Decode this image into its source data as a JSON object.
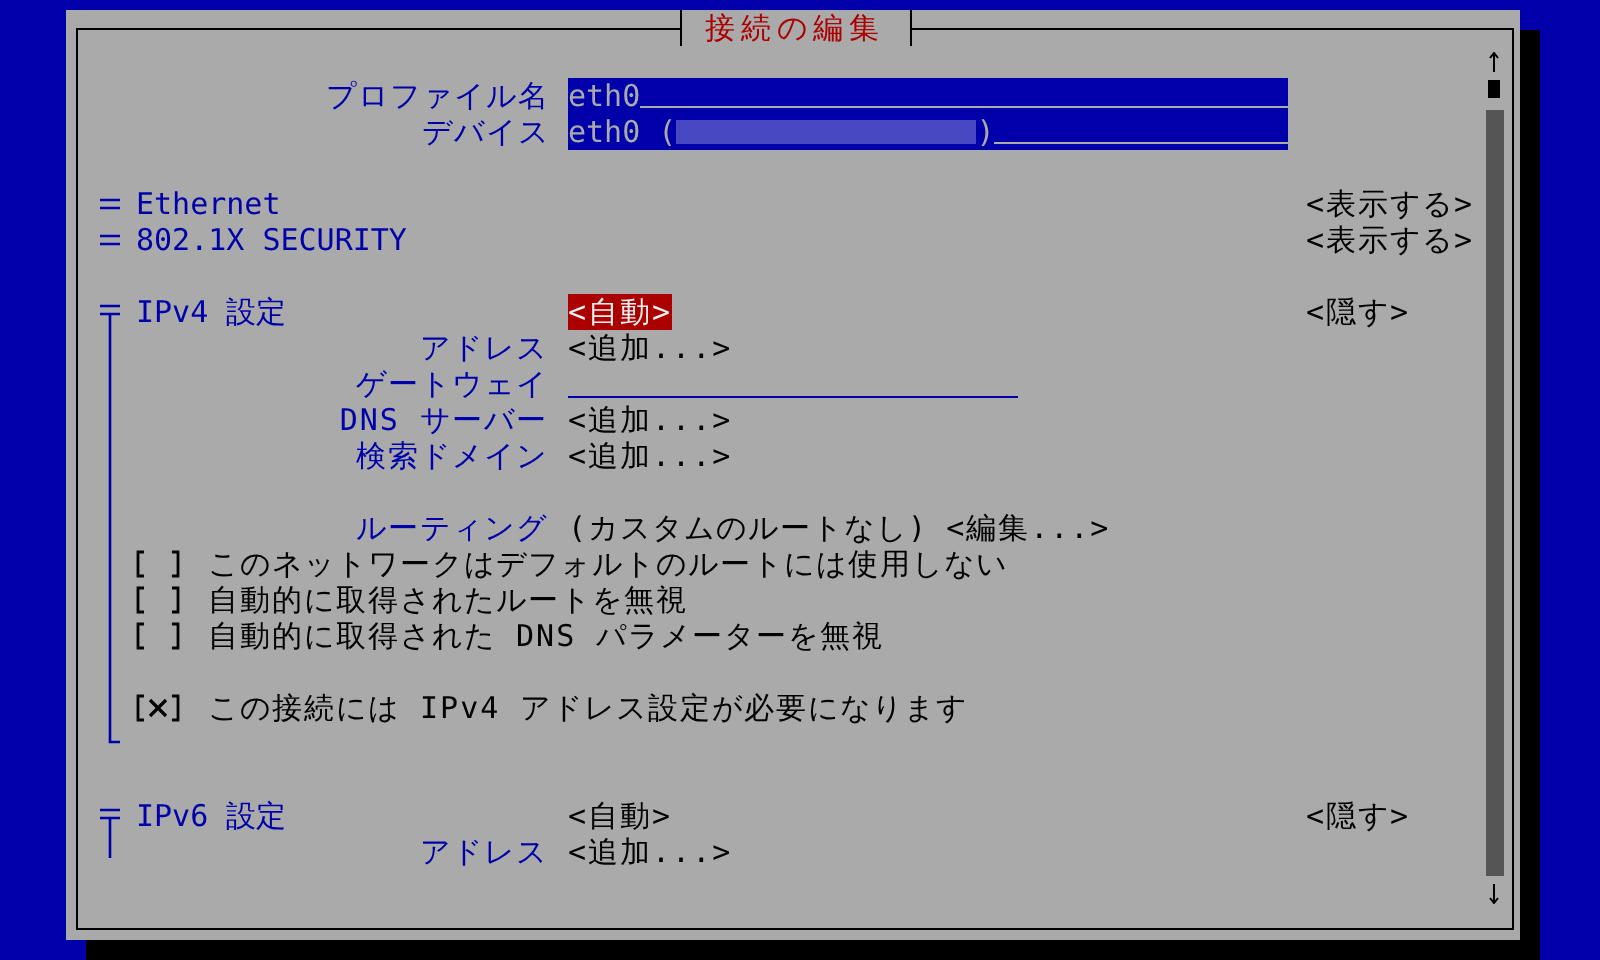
{
  "dialog": {
    "title": "接続の編集"
  },
  "fields": [
    {
      "label": "プロファイル名",
      "value": "eth0"
    },
    {
      "label": "デバイス",
      "value": "eth0 (",
      "value_end": ")",
      "redacted": true
    }
  ],
  "collapsed_sections": [
    {
      "title": "Ethernet",
      "toggle": "<表示する>"
    },
    {
      "title": "802.1X SECURITY",
      "toggle": "<表示する>"
    }
  ],
  "sections": [
    {
      "title": "IPv4 設定",
      "mode": "<自動>",
      "mode_focused": true,
      "toggle": "<隠す>",
      "rows": [
        {
          "kind": "button",
          "label": "アドレス",
          "value": "<追加...>"
        },
        {
          "kind": "input",
          "label": "ゲートウェイ"
        },
        {
          "kind": "button",
          "label": "DNS サーバー",
          "value": "<追加...>"
        },
        {
          "kind": "button",
          "label": "検索ドメイン",
          "value": "<追加...>"
        },
        {
          "kind": "spacer"
        },
        {
          "kind": "routing",
          "label": "ルーティング",
          "note": "(カスタムのルートなし)",
          "value": "<編集...>"
        },
        {
          "kind": "checkbox",
          "label": "このネットワークはデフォルトのルートには使用しない",
          "checked": false
        },
        {
          "kind": "checkbox",
          "label": "自動的に取得されたルートを無視",
          "checked": false
        },
        {
          "kind": "checkbox",
          "label": "自動的に取得された DNS パラメーターを無視",
          "checked": false
        },
        {
          "kind": "spacer"
        },
        {
          "kind": "checkbox",
          "label": "この接続には IPv4 アドレス設定が必要になります",
          "checked": true
        }
      ],
      "closed": true
    },
    {
      "title": "IPv6 設定",
      "mode": "<自動>",
      "mode_focused": false,
      "toggle": "<隠す>",
      "rows": [
        {
          "kind": "button",
          "label": "アドレス",
          "value": "<追加...>"
        }
      ],
      "closed": false
    }
  ]
}
